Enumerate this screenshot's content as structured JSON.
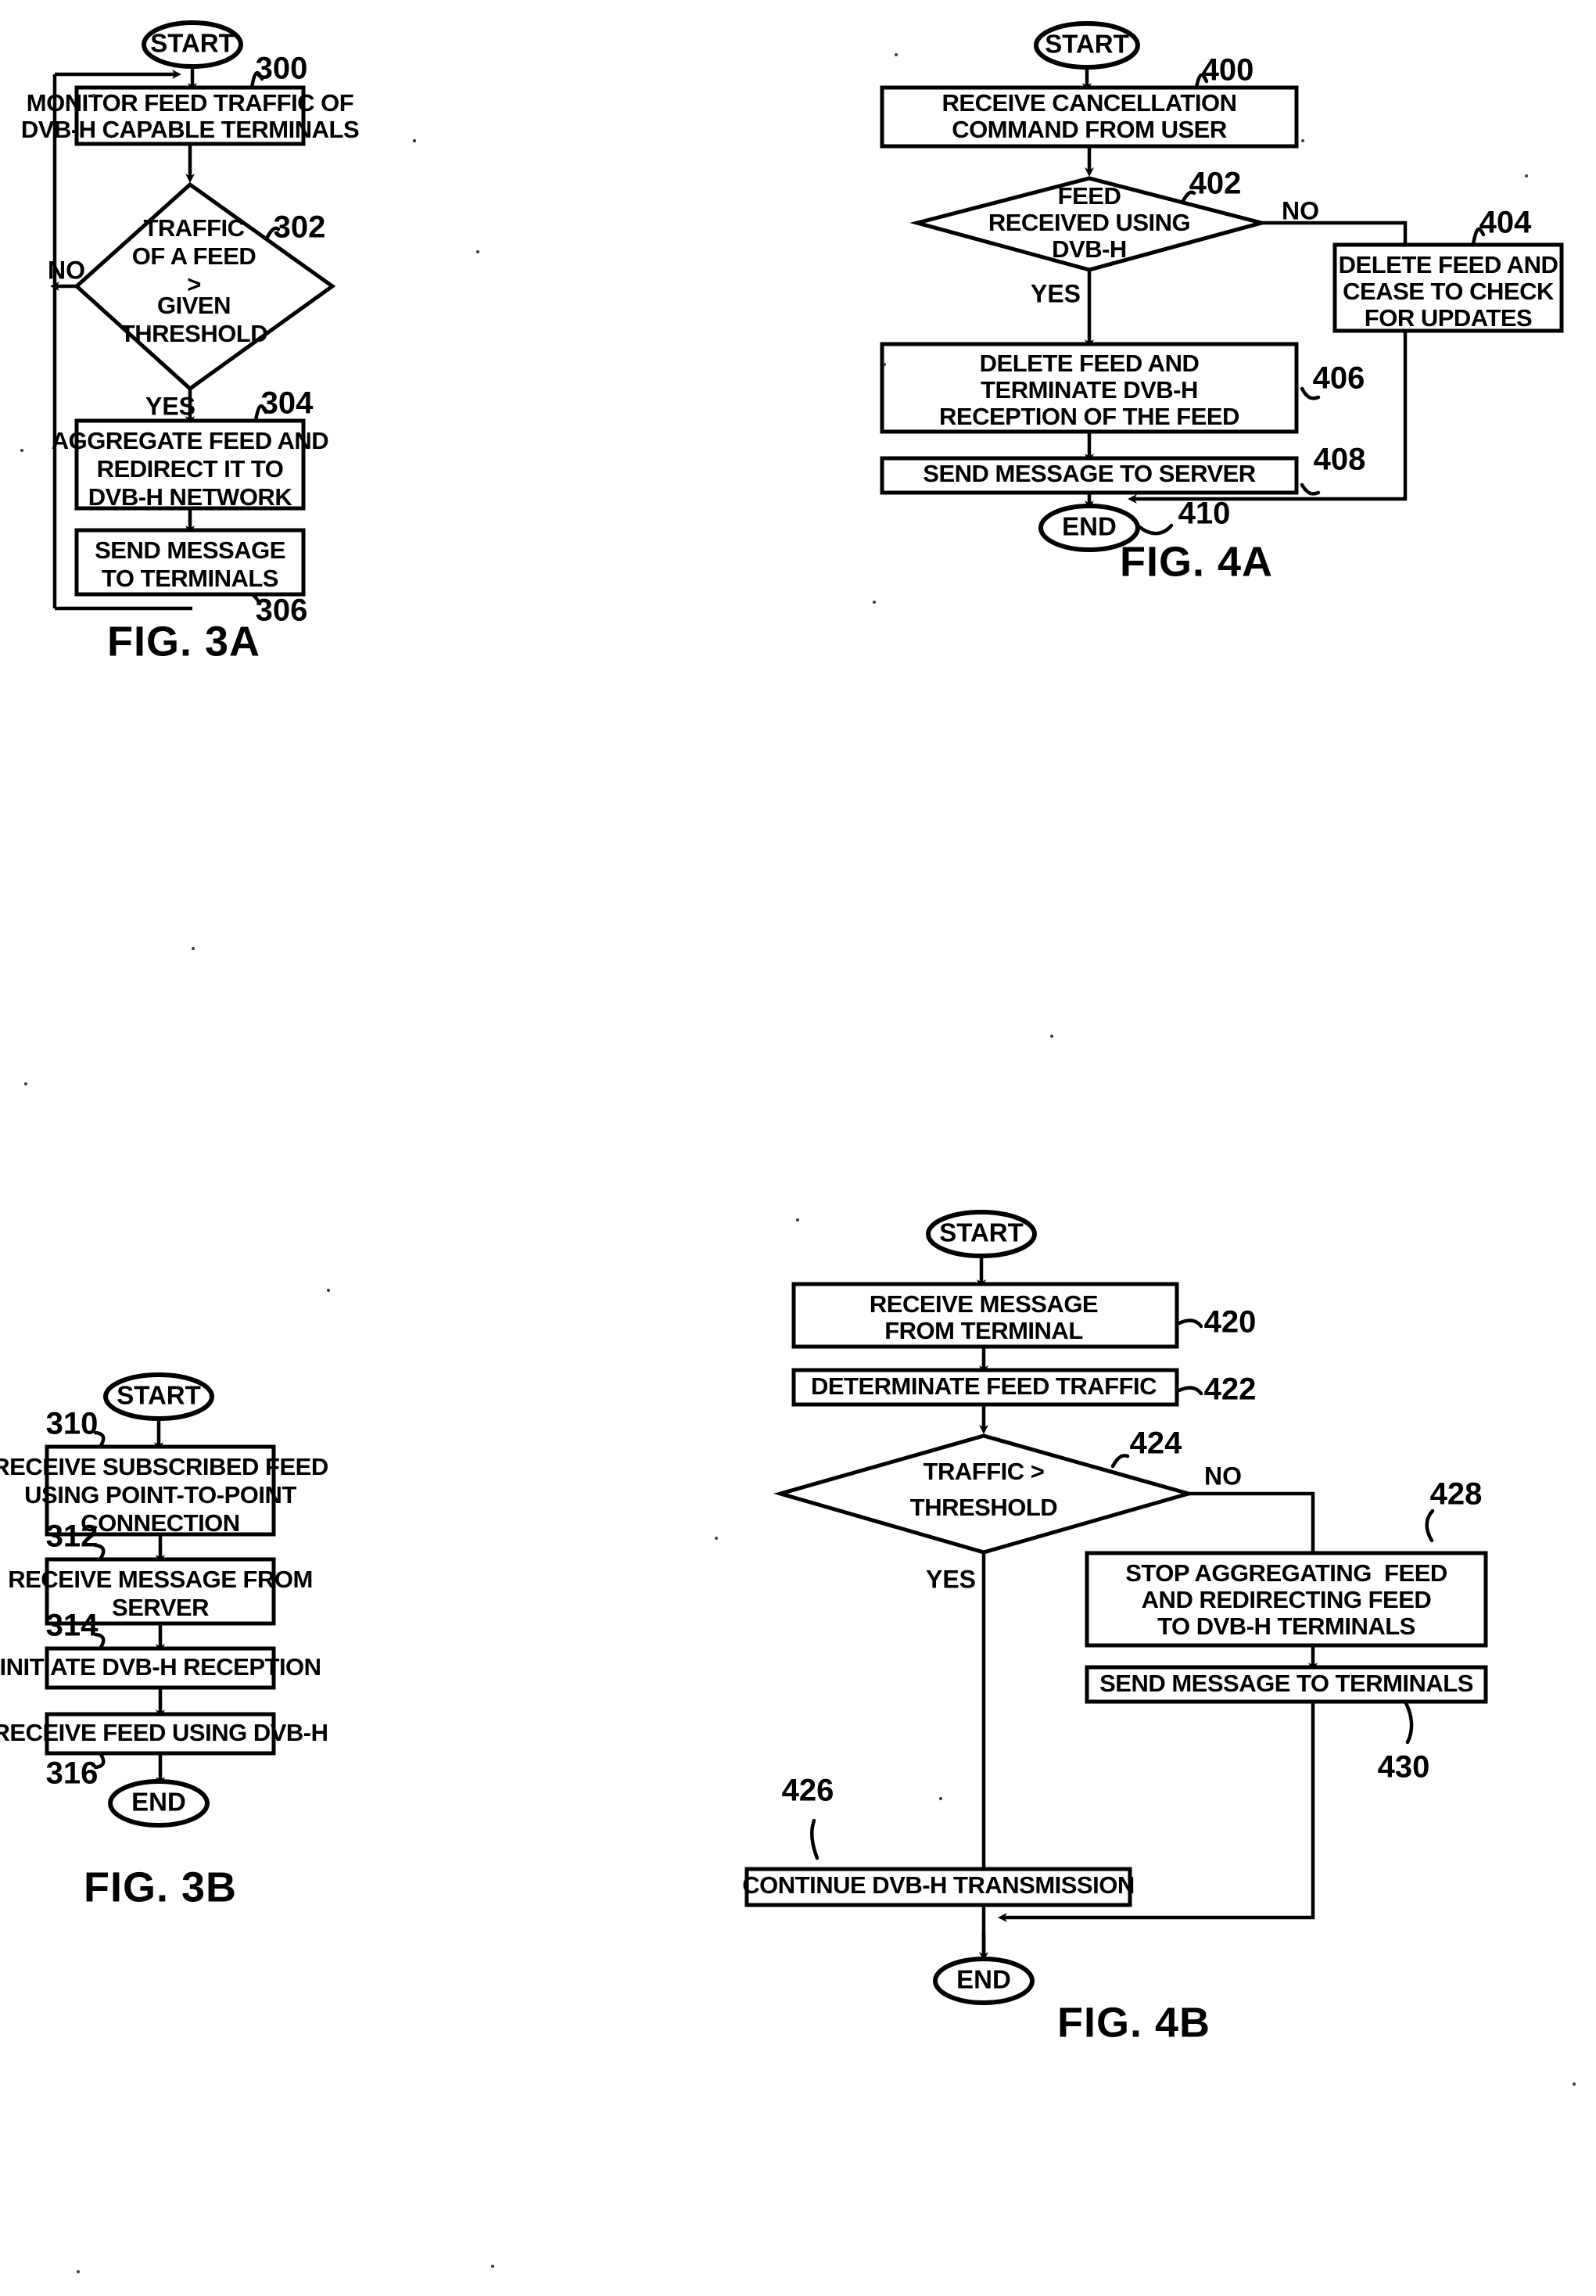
{
  "document": {
    "kind": "patent-flowchart-sheet",
    "figures": [
      "FIG. 3A",
      "FIG. 3B",
      "FIG. 4A",
      "FIG. 4B"
    ]
  },
  "fig3a": {
    "label": "FIG. 3A",
    "start": "START",
    "n300": {
      "ref": "300",
      "lines": [
        "MONITOR FEED TRAFFIC OF",
        "DVB-H CAPABLE TERMINALS"
      ]
    },
    "n302": {
      "ref": "302",
      "lines": [
        "TRAFFIC",
        "OF A FEED",
        ">",
        "GIVEN",
        "THRESHOLD"
      ],
      "yes": "YES",
      "no": "NO"
    },
    "n304": {
      "ref": "304",
      "lines": [
        "AGGREGATE FEED AND",
        "REDIRECT IT TO",
        "DVB-H NETWORK"
      ]
    },
    "n306": {
      "ref": "306",
      "lines": [
        "SEND MESSAGE",
        "TO TERMINALS"
      ]
    }
  },
  "fig3b": {
    "label": "FIG. 3B",
    "start": "START",
    "end": "END",
    "n310": {
      "ref": "310",
      "lines": [
        "RECEIVE SUBSCRIBED FEED",
        "USING POINT-TO-POINT",
        "CONNECTION"
      ]
    },
    "n312": {
      "ref": "312",
      "lines": [
        "RECEIVE MESSAGE FROM",
        "SERVER"
      ]
    },
    "n314": {
      "ref": "314",
      "lines": [
        "INITIATE DVB-H RECEPTION"
      ]
    },
    "n316": {
      "ref": "316",
      "lines": [
        "RECEIVE FEED USING DVB-H"
      ]
    }
  },
  "fig4a": {
    "label": "FIG. 4A",
    "start": "START",
    "end": "END",
    "n400": {
      "ref": "400",
      "lines": [
        "RECEIVE CANCELLATION",
        "COMMAND FROM USER"
      ]
    },
    "n402": {
      "ref": "402",
      "lines": [
        "FEED",
        "RECEIVED USING",
        "DVB-H"
      ],
      "yes": "YES",
      "no": "NO"
    },
    "n404": {
      "ref": "404",
      "lines": [
        "DELETE FEED AND",
        "CEASE TO CHECK",
        "FOR UPDATES"
      ]
    },
    "n406": {
      "ref": "406",
      "lines": [
        "DELETE FEED AND",
        "TERMINATE DVB-H",
        "RECEPTION OF THE FEED"
      ]
    },
    "n408": {
      "ref": "408",
      "lines": [
        "SEND MESSAGE TO SERVER"
      ]
    },
    "n410": {
      "ref": "410"
    }
  },
  "fig4b": {
    "label": "FIG. 4B",
    "start": "START",
    "end": "END",
    "n420": {
      "ref": "420",
      "lines": [
        "RECEIVE MESSAGE",
        "FROM TERMINAL"
      ]
    },
    "n422": {
      "ref": "422",
      "lines": [
        "DETERMINATE FEED TRAFFIC"
      ]
    },
    "n424": {
      "ref": "424",
      "lines": [
        "TRAFFIC >",
        "THRESHOLD"
      ],
      "yes": "YES",
      "no": "NO"
    },
    "n426": {
      "ref": "426",
      "lines": [
        "CONTINUE DVB-H TRANSMISSION"
      ]
    },
    "n428": {
      "ref": "428",
      "lines": [
        "STOP AGGREGATING  FEED",
        "AND REDIRECTING FEED",
        "TO DVB-H TERMINALS"
      ]
    },
    "n430": {
      "ref": "430",
      "lines": [
        "SEND MESSAGE TO TERMINALS"
      ]
    }
  }
}
